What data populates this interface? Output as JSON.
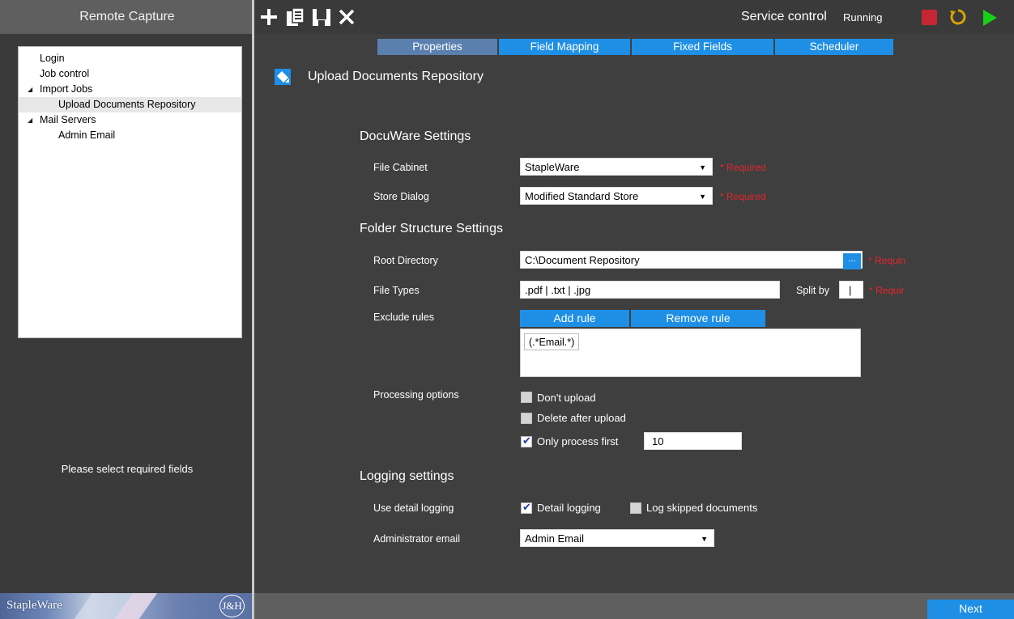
{
  "app": {
    "title": "Remote Capture"
  },
  "tree": {
    "items": [
      {
        "label": "Login",
        "level": 0,
        "expander": ""
      },
      {
        "label": "Job control",
        "level": 0,
        "expander": ""
      },
      {
        "label": "Import Jobs",
        "level": 0,
        "expander": "◢"
      },
      {
        "label": "Upload Documents Repository",
        "level": 2,
        "expander": "",
        "selected": true
      },
      {
        "label": "Mail Servers",
        "level": 0,
        "expander": "◢"
      },
      {
        "label": "Admin Email",
        "level": 2,
        "expander": ""
      }
    ]
  },
  "left_status": "Please select required fields",
  "branding": {
    "logo_text": "StapleWare",
    "partner_logo": "J&H"
  },
  "toolbar": {
    "icons": [
      "add-icon",
      "copy-document-icon",
      "save-icon",
      "close-icon"
    ],
    "service_label": "Service control",
    "service_status": "Running",
    "controls": [
      "stop-icon",
      "restart-icon",
      "play-icon"
    ]
  },
  "tabs": [
    {
      "label": "Properties",
      "active": true
    },
    {
      "label": "Field Mapping",
      "active": false
    },
    {
      "label": "Fixed Fields",
      "active": false
    },
    {
      "label": "Scheduler",
      "active": false
    }
  ],
  "page": {
    "title": "Upload Documents Repository",
    "icon": "edit-pen-icon"
  },
  "docuware": {
    "heading": "DocuWare Settings",
    "file_cabinet": {
      "label": "File Cabinet",
      "value": "StapleWare",
      "required": "* Required"
    },
    "store_dialog": {
      "label": "Store Dialog",
      "value": "Modified Standard Store",
      "required": "* Required"
    }
  },
  "folder": {
    "heading": "Folder Structure Settings",
    "root_directory": {
      "label": "Root Directory",
      "value": "C:\\Document Repository",
      "browse": "...",
      "required": "* Requin"
    },
    "file_types": {
      "label": "File Types",
      "value": ".pdf | .txt | .jpg",
      "split_label": "Split by",
      "split_value": "|",
      "required": "* Requir"
    },
    "exclude_rules": {
      "label": "Exclude rules",
      "add": "Add rule",
      "remove": "Remove rule",
      "items": [
        "(.*Email.*)"
      ]
    },
    "processing": {
      "label": "Processing options",
      "dont_upload": {
        "label": "Don't upload",
        "checked": false
      },
      "delete_after": {
        "label": "Delete after upload",
        "checked": false
      },
      "only_first": {
        "label": "Only process first",
        "checked": true,
        "value": "10"
      }
    }
  },
  "logging": {
    "heading": "Logging settings",
    "detail": {
      "label": "Use detail logging",
      "detail_logging": {
        "label": "Detail logging",
        "checked": true
      },
      "log_skipped": {
        "label": "Log skipped documents",
        "checked": false
      }
    },
    "admin_email": {
      "label": "Administrator email",
      "value": "Admin Email"
    }
  },
  "footer": {
    "next": "Next"
  },
  "colors": {
    "accent": "#1f8fe6",
    "active_tab": "#5b7fae",
    "required": "#e3262d",
    "stop": "#c62634",
    "restart": "#d9a300",
    "play": "#17d117"
  }
}
